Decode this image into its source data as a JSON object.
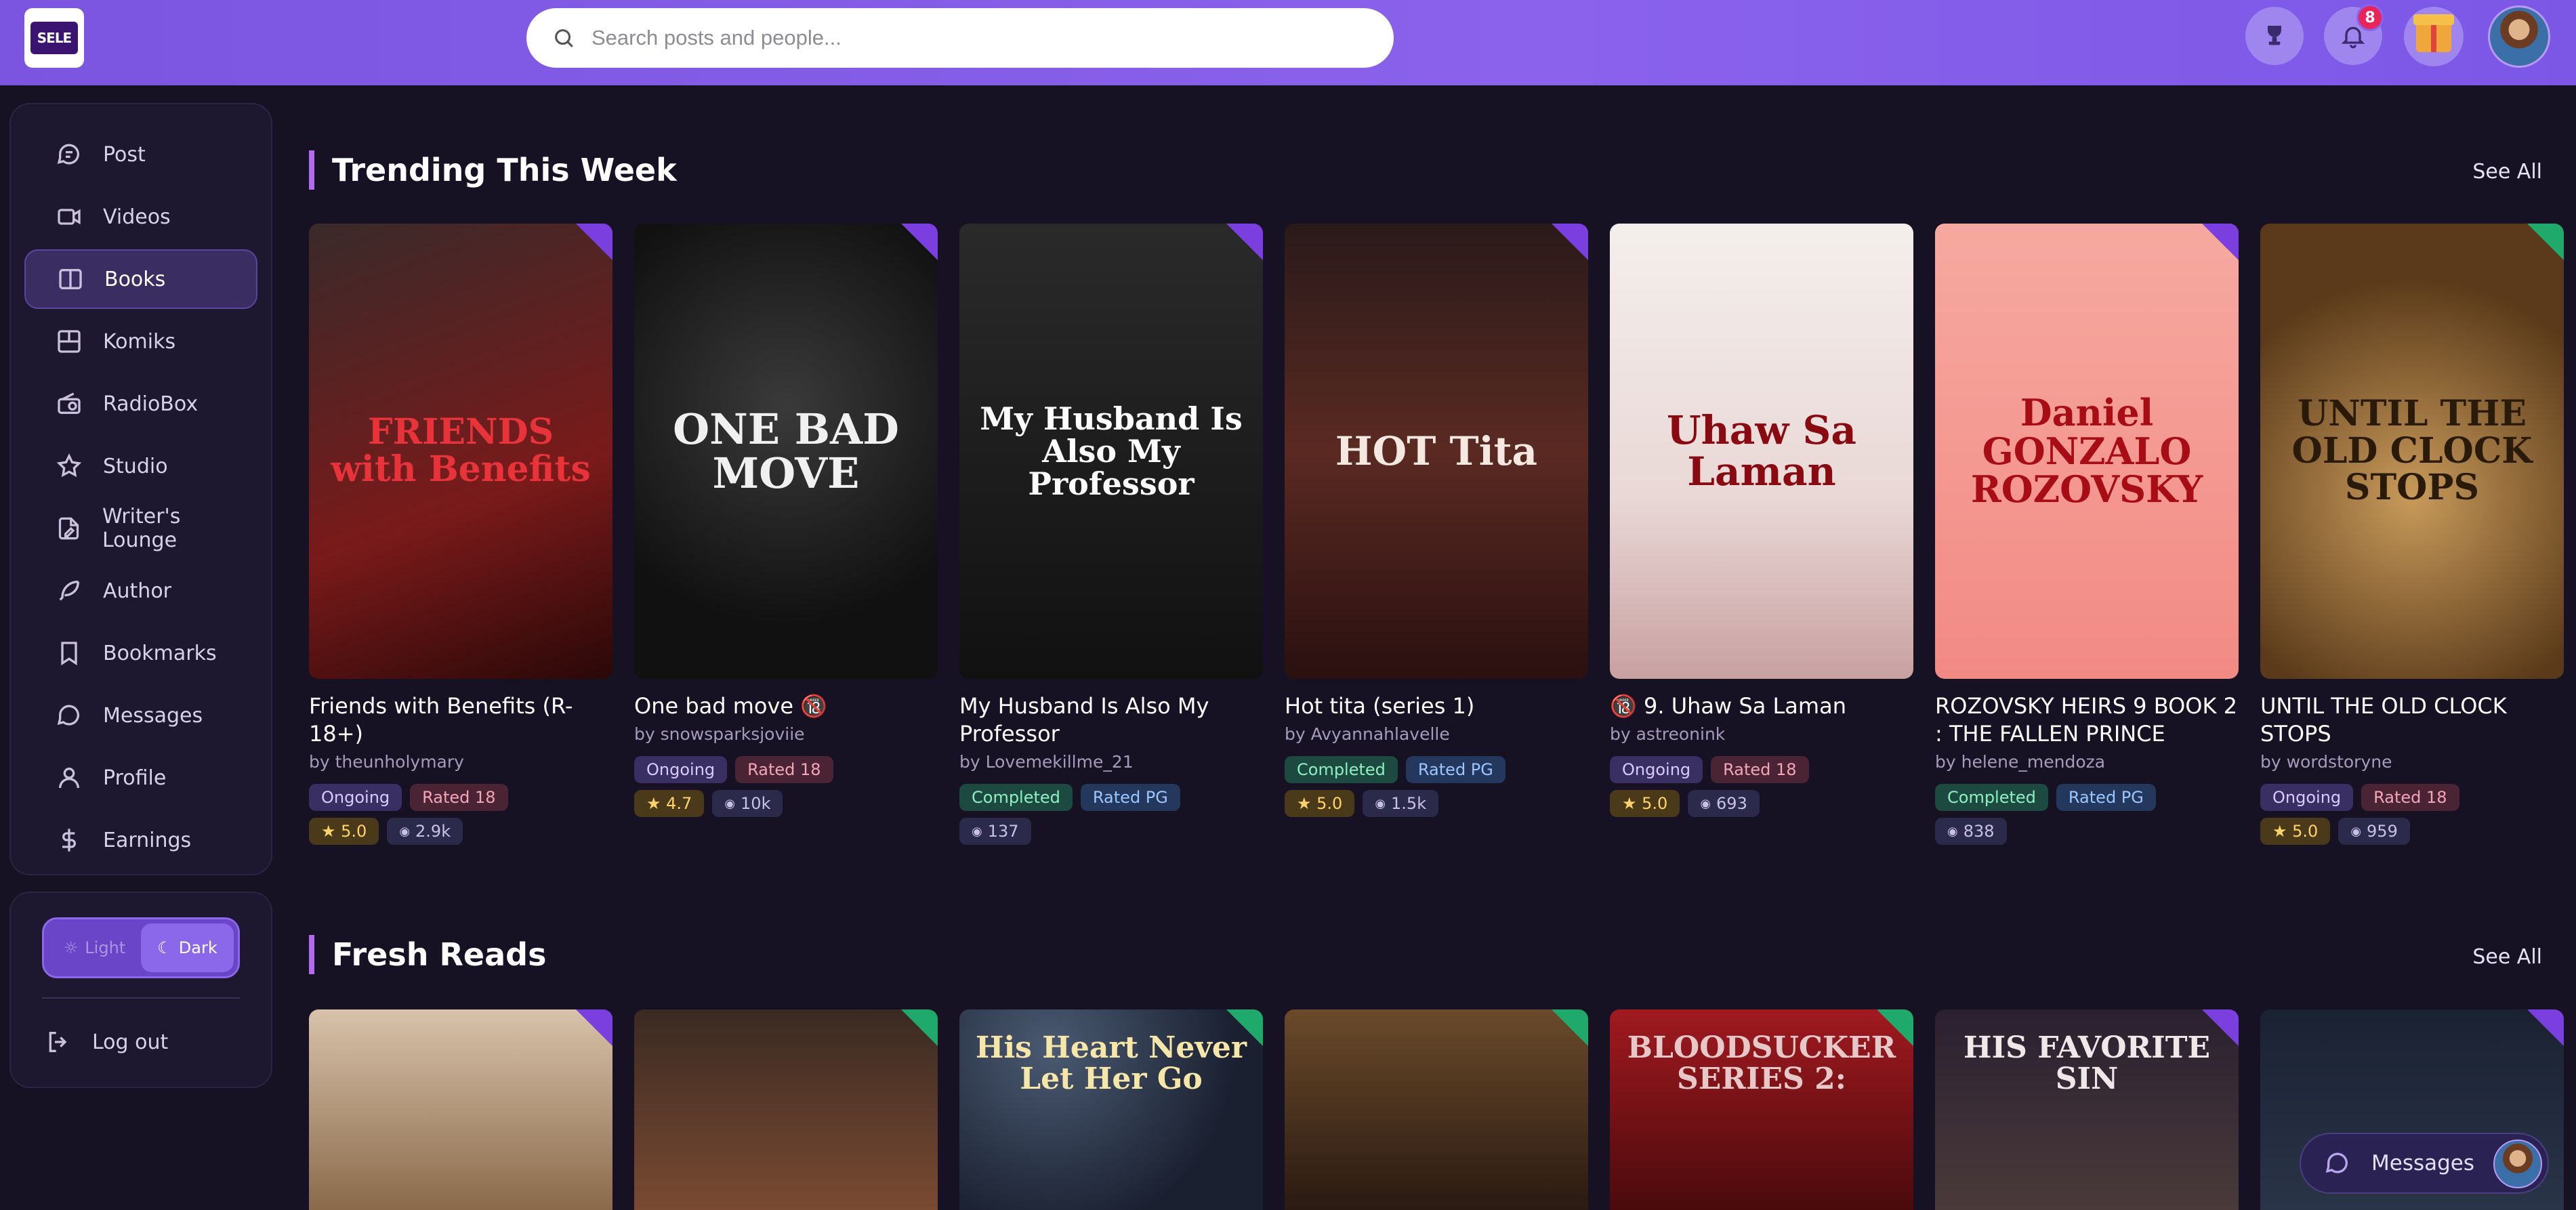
{
  "header": {
    "logo_text": "SELE",
    "search_placeholder": "Search posts and people...",
    "notification_count": "8"
  },
  "sidebar": {
    "items": [
      {
        "label": "Post",
        "icon": "chat-bubble-icon"
      },
      {
        "label": "Videos",
        "icon": "video-camera-icon"
      },
      {
        "label": "Books",
        "icon": "book-open-icon",
        "active": true
      },
      {
        "label": "Komiks",
        "icon": "grid-panels-icon"
      },
      {
        "label": "RadioBox",
        "icon": "radio-icon"
      },
      {
        "label": "Studio",
        "icon": "star-icon"
      },
      {
        "label": "Writer's Lounge",
        "icon": "document-pen-icon"
      },
      {
        "label": "Author",
        "icon": "feather-pen-icon"
      },
      {
        "label": "Bookmarks",
        "icon": "bookmark-icon"
      },
      {
        "label": "Messages",
        "icon": "message-circle-icon"
      },
      {
        "label": "Profile",
        "icon": "user-icon"
      },
      {
        "label": "Earnings",
        "icon": "dollar-icon"
      }
    ],
    "theme": {
      "light": "Light",
      "dark": "Dark",
      "selected": "Dark"
    },
    "logout": "Log out"
  },
  "trending": {
    "title": "Trending This Week",
    "see_all": "See All",
    "books": [
      {
        "title": "Friends with Benefits (R-18+)",
        "author": "by theunholymary",
        "status": "Ongoing",
        "rating": "Rated 18",
        "stars": "★ 5.0",
        "views": "2.9k",
        "cover_text": "FRIENDS with Benefits"
      },
      {
        "title": "One bad move 🔞",
        "author": "by snowsparksjoviie",
        "status": "Ongoing",
        "rating": "Rated 18",
        "stars": "★ 4.7",
        "views": "10k",
        "cover_text": "ONE BAD MOVE"
      },
      {
        "title": "My Husband Is Also My Professor",
        "author": "by Lovemekillme_21",
        "status": "Completed",
        "rating": "Rated PG",
        "stars": "",
        "views": "137",
        "cover_text": "My Husband Is Also My Professor"
      },
      {
        "title": "Hot tita (series 1)",
        "author": "by Avyannahlavelle",
        "status": "Completed",
        "rating": "Rated PG",
        "stars": "★ 5.0",
        "views": "1.5k",
        "cover_text": "HOT Tita"
      },
      {
        "title": "🔞 9. Uhaw Sa Laman",
        "author": "by astreonink",
        "status": "Ongoing",
        "rating": "Rated 18",
        "stars": "★ 5.0",
        "views": "693",
        "cover_text": "Uhaw Sa Laman"
      },
      {
        "title": "ROZOVSKY HEIRS 9 BOOK 2 : THE FALLEN PRINCE",
        "author": "by helene_mendoza",
        "status": "Completed",
        "rating": "Rated PG",
        "stars": "",
        "views": "838",
        "cover_text": "Daniel GONZALO ROZOVSKY"
      },
      {
        "title": "UNTIL THE OLD CLOCK STOPS",
        "author": "by wordstoryne",
        "status": "Ongoing",
        "rating": "Rated 18",
        "stars": "★ 5.0",
        "views": "959",
        "cover_text": "UNTIL THE OLD CLOCK STOPS"
      }
    ]
  },
  "fresh": {
    "title": "Fresh Reads",
    "see_all": "See All",
    "covers": [
      "",
      "",
      "His Heart Never Let Her Go",
      "",
      "BLOODSUCKER SERIES 2:",
      "HIS FAVORITE SIN",
      ""
    ]
  },
  "messages_button": "Messages"
}
